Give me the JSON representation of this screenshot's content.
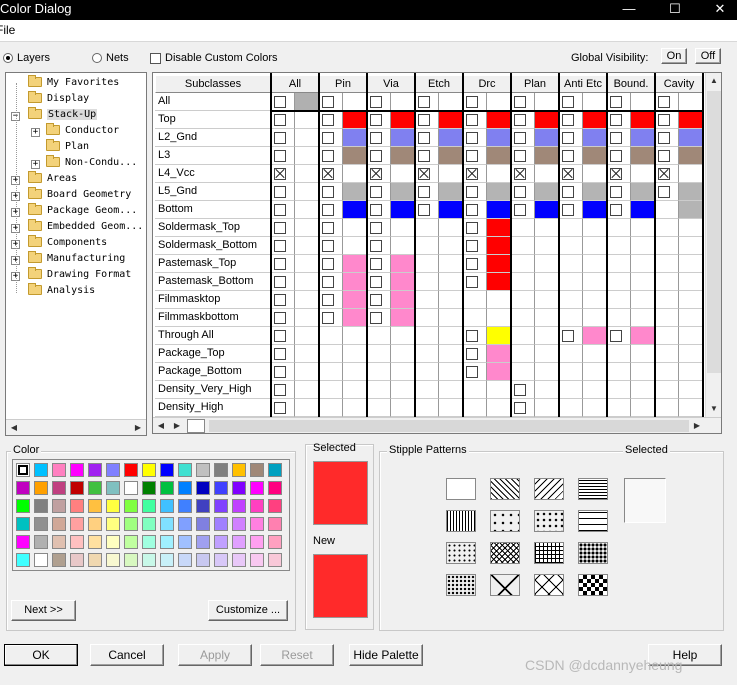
{
  "window": {
    "title": "Color Dialog",
    "minimize": "—",
    "maximize": "☐",
    "close": "✕"
  },
  "menu": {
    "file": "File"
  },
  "options": {
    "layers": "Layers",
    "nets": "Nets",
    "disable_custom": "Disable Custom Colors",
    "global_visibility": "Global Visibility:",
    "on": "On",
    "off": "Off"
  },
  "tree": [
    {
      "label": "My Favorites",
      "level": 0
    },
    {
      "label": "Display",
      "level": 0
    },
    {
      "label": "Stack-Up",
      "level": 0,
      "expanded": true,
      "selected": true
    },
    {
      "label": "Conductor",
      "level": 1,
      "expander": "+"
    },
    {
      "label": "Plan",
      "level": 1
    },
    {
      "label": "Non-Condu...",
      "level": 1,
      "expander": "+"
    },
    {
      "label": "Areas",
      "level": 0,
      "expander": "+"
    },
    {
      "label": "Board Geometry",
      "level": 0,
      "expander": "+"
    },
    {
      "label": "Package Geom...",
      "level": 0,
      "expander": "+"
    },
    {
      "label": "Embedded Geom...",
      "level": 0,
      "expander": "+"
    },
    {
      "label": "Components",
      "level": 0,
      "expander": "+"
    },
    {
      "label": "Manufacturing",
      "level": 0,
      "expander": "+"
    },
    {
      "label": "Drawing Format",
      "level": 0,
      "expander": "+"
    },
    {
      "label": "Analysis",
      "level": 0
    }
  ],
  "grid": {
    "header_label": "Subclasses",
    "columns": [
      "All",
      "Pin",
      "Via",
      "Etch",
      "Drc",
      "Plan",
      "Anti Etc",
      "Bound.",
      "Cavity"
    ],
    "rows": [
      {
        "name": "All",
        "cells": [
          [
            "cb",
            "#b0b0b0"
          ],
          [
            "cb",
            "#fff"
          ],
          [
            "cb",
            "#fff"
          ],
          [
            "cb",
            "#fff"
          ],
          [
            "cb",
            "#fff"
          ],
          [
            "cb",
            "#fff"
          ],
          [
            "cb",
            "#fff"
          ],
          [
            "cb",
            "#fff"
          ],
          [
            "cb",
            "#fff"
          ]
        ]
      },
      {
        "name": "Top",
        "cells": [
          [
            "cb",
            ""
          ],
          [
            "cb",
            "#ff0000"
          ],
          [
            "cb",
            "#ff0000"
          ],
          [
            "cb",
            "#ff0000"
          ],
          [
            "cb",
            "#ff0000"
          ],
          [
            "cb",
            "#ff0000"
          ],
          [
            "cb",
            "#ff0000"
          ],
          [
            "cb",
            "#ff0000"
          ],
          [
            "cb",
            "#ff0000"
          ]
        ]
      },
      {
        "name": "L2_Gnd",
        "cells": [
          [
            "cb",
            ""
          ],
          [
            "cb",
            "#8080f0"
          ],
          [
            "cb",
            "#8080f0"
          ],
          [
            "cb",
            "#8080f0"
          ],
          [
            "cb",
            "#8080f0"
          ],
          [
            "cb",
            "#8080f0"
          ],
          [
            "cb",
            "#8080f0"
          ],
          [
            "cb",
            "#8080f0"
          ],
          [
            "cb",
            "#8080f0"
          ]
        ]
      },
      {
        "name": "L3",
        "cells": [
          [
            "cb",
            ""
          ],
          [
            "cb",
            "#a08878"
          ],
          [
            "cb",
            "#a08878"
          ],
          [
            "cb",
            "#a08878"
          ],
          [
            "cb",
            "#a08878"
          ],
          [
            "cb",
            "#a08878"
          ],
          [
            "cb",
            "#a08878"
          ],
          [
            "cb",
            "#a08878"
          ],
          [
            "cb",
            "#a08878"
          ]
        ]
      },
      {
        "name": "L4_Vcc",
        "cells": [
          [
            "x",
            ""
          ],
          [
            "x",
            ""
          ],
          [
            "x",
            ""
          ],
          [
            "x",
            ""
          ],
          [
            "x",
            ""
          ],
          [
            "x",
            ""
          ],
          [
            "x",
            ""
          ],
          [
            "x",
            ""
          ],
          [
            "x",
            ""
          ]
        ]
      },
      {
        "name": "L5_Gnd",
        "cells": [
          [
            "cb",
            ""
          ],
          [
            "cb",
            "#b4b4b4"
          ],
          [
            "cb",
            "#b4b4b4"
          ],
          [
            "cb",
            "#b4b4b4"
          ],
          [
            "cb",
            "#b4b4b4"
          ],
          [
            "cb",
            "#b4b4b4"
          ],
          [
            "cb",
            "#b4b4b4"
          ],
          [
            "cb",
            "#b4b4b4"
          ],
          [
            "cb",
            "#b4b4b4"
          ]
        ]
      },
      {
        "name": "Bottom",
        "cells": [
          [
            "cb",
            ""
          ],
          [
            "cb",
            "#0000ff"
          ],
          [
            "cb",
            "#0000ff"
          ],
          [
            "cb",
            "#0000ff"
          ],
          [
            "cb",
            "#0000ff"
          ],
          [
            "cb",
            "#0000ff"
          ],
          [
            "cb",
            "#0000ff"
          ],
          [
            "cb",
            "#0000ff"
          ],
          [
            "none",
            "#b4b4b4"
          ]
        ]
      },
      {
        "name": "Soldermask_Top",
        "cells": [
          [
            "cb",
            ""
          ],
          [
            "cb",
            ""
          ],
          [
            "cb",
            ""
          ],
          [
            "",
            ""
          ],
          [
            "cb",
            "#ff0000"
          ],
          [
            "",
            ""
          ],
          [
            "",
            ""
          ],
          [
            "",
            ""
          ],
          [
            "",
            ""
          ]
        ]
      },
      {
        "name": "Soldermask_Bottom",
        "cells": [
          [
            "cb",
            ""
          ],
          [
            "cb",
            ""
          ],
          [
            "cb",
            ""
          ],
          [
            "",
            ""
          ],
          [
            "cb",
            "#ff0000"
          ],
          [
            "",
            ""
          ],
          [
            "",
            ""
          ],
          [
            "",
            ""
          ],
          [
            "",
            ""
          ]
        ]
      },
      {
        "name": "Pastemask_Top",
        "cells": [
          [
            "cb",
            ""
          ],
          [
            "cb",
            "#ff88cc"
          ],
          [
            "cb",
            "#ff88cc"
          ],
          [
            "",
            ""
          ],
          [
            "cb",
            "#ff0000"
          ],
          [
            "",
            ""
          ],
          [
            "",
            ""
          ],
          [
            "",
            ""
          ],
          [
            "",
            ""
          ]
        ]
      },
      {
        "name": "Pastemask_Bottom",
        "cells": [
          [
            "cb",
            ""
          ],
          [
            "cb",
            "#ff88cc"
          ],
          [
            "cb",
            "#ff88cc"
          ],
          [
            "",
            ""
          ],
          [
            "cb",
            "#ff0000"
          ],
          [
            "",
            ""
          ],
          [
            "",
            ""
          ],
          [
            "",
            ""
          ],
          [
            "",
            ""
          ]
        ]
      },
      {
        "name": "Filmmasktop",
        "cells": [
          [
            "cb",
            ""
          ],
          [
            "cb",
            "#ff88cc"
          ],
          [
            "cb",
            "#ff88cc"
          ],
          [
            "",
            ""
          ],
          [
            "",
            ""
          ],
          [
            "",
            ""
          ],
          [
            "",
            ""
          ],
          [
            "",
            ""
          ],
          [
            "",
            ""
          ]
        ]
      },
      {
        "name": "Filmmaskbottom",
        "cells": [
          [
            "cb",
            ""
          ],
          [
            "cb",
            "#ff88cc"
          ],
          [
            "cb",
            "#ff88cc"
          ],
          [
            "",
            ""
          ],
          [
            "",
            ""
          ],
          [
            "",
            ""
          ],
          [
            "",
            ""
          ],
          [
            "",
            ""
          ],
          [
            "",
            ""
          ]
        ]
      },
      {
        "name": "Through All",
        "cells": [
          [
            "cb",
            ""
          ],
          [
            "",
            ""
          ],
          [
            "",
            ""
          ],
          [
            "",
            ""
          ],
          [
            "cb",
            "#ffff00"
          ],
          [
            "",
            ""
          ],
          [
            "cb",
            "#ff88cc"
          ],
          [
            "cb",
            "#ff88cc"
          ],
          [
            "",
            ""
          ]
        ]
      },
      {
        "name": "Package_Top",
        "cells": [
          [
            "cb",
            ""
          ],
          [
            "",
            ""
          ],
          [
            "",
            ""
          ],
          [
            "",
            ""
          ],
          [
            "cb",
            "#ff88cc"
          ],
          [
            "",
            ""
          ],
          [
            "",
            ""
          ],
          [
            "",
            ""
          ],
          [
            "",
            ""
          ]
        ]
      },
      {
        "name": "Package_Bottom",
        "cells": [
          [
            "cb",
            ""
          ],
          [
            "",
            ""
          ],
          [
            "",
            ""
          ],
          [
            "",
            ""
          ],
          [
            "cb",
            "#ff88cc"
          ],
          [
            "",
            ""
          ],
          [
            "",
            ""
          ],
          [
            "",
            ""
          ],
          [
            "",
            ""
          ]
        ]
      },
      {
        "name": "Density_Very_High",
        "cells": [
          [
            "cb",
            ""
          ],
          [
            "",
            ""
          ],
          [
            "",
            ""
          ],
          [
            "",
            ""
          ],
          [
            "",
            ""
          ],
          [
            "cb",
            ""
          ],
          [
            "",
            ""
          ],
          [
            "",
            ""
          ],
          [
            "",
            ""
          ]
        ]
      },
      {
        "name": "Density_High",
        "cells": [
          [
            "cb",
            ""
          ],
          [
            "",
            ""
          ],
          [
            "",
            ""
          ],
          [
            "",
            ""
          ],
          [
            "",
            ""
          ],
          [
            "cb",
            ""
          ],
          [
            "",
            ""
          ],
          [
            "",
            ""
          ],
          [
            "",
            ""
          ]
        ]
      }
    ]
  },
  "color_panel": {
    "label": "Color",
    "next_button": "Next >>",
    "customize_button": "Customize ...",
    "palette": [
      [
        "#ffffff",
        "#00c0ff",
        "#ff80c0",
        "#ff00ff",
        "#a020f0",
        "#8080ff",
        "#ff0000",
        "#ffff00",
        "#0000ff",
        "#40e0d0",
        "#c0c0c0",
        "#808080",
        "#ffc000",
        "#a08878",
        "#00a0c0"
      ],
      [
        "#c000c0",
        "#ffa000",
        "#c04080",
        "#c00000",
        "#40c040",
        "#80c0c0",
        "#ffffff",
        "#008000",
        "#00c040",
        "#0080ff",
        "#0000c0",
        "#4040ff",
        "#8000ff",
        "#ff00ff",
        "#ff0080"
      ],
      [
        "#00ff00",
        "#808080",
        "#c0a0a0",
        "#ff8080",
        "#ffc040",
        "#ffff40",
        "#80ff40",
        "#40ffa0",
        "#40c0ff",
        "#4080ff",
        "#4040c0",
        "#8040ff",
        "#c040ff",
        "#ff40c0",
        "#ff4080"
      ],
      [
        "#00c0c0",
        "#909090",
        "#d0a898",
        "#ffa0a0",
        "#ffd080",
        "#ffff80",
        "#a0ff80",
        "#80ffc0",
        "#80e0ff",
        "#80a0ff",
        "#8080e0",
        "#a080ff",
        "#d080ff",
        "#ff80e0",
        "#ff80b0"
      ],
      [
        "#ff00ff",
        "#b0b0b0",
        "#e0c0b0",
        "#ffc0c0",
        "#ffe0a0",
        "#ffffc0",
        "#c0ffa0",
        "#a0ffe0",
        "#a0f0ff",
        "#a0c0ff",
        "#a0a0f0",
        "#c0a0ff",
        "#e0a0ff",
        "#ffa0f0",
        "#ffa0c0"
      ],
      [
        "#40ffff",
        "#ffffff",
        "#b0a090",
        "#e8c8c8",
        "#f0d8b0",
        "#f8f8d0",
        "#d8f8c0",
        "#c8f8e8",
        "#c8f0f8",
        "#c8d8f8",
        "#c8c8f0",
        "#d8c8f8",
        "#e8c8f8",
        "#f8c8f0",
        "#f8c8d8"
      ]
    ]
  },
  "selected_panel": {
    "selected": "Selected",
    "new": "New",
    "selected_color": "#ff2a2a",
    "new_color": "#ff2a2a"
  },
  "stipple_panel": {
    "label": "Stipple Patterns",
    "selected": "Selected"
  },
  "footer": {
    "ok": "OK",
    "cancel": "Cancel",
    "apply": "Apply",
    "reset": "Reset",
    "hide_palette": "Hide Palette",
    "help": "Help"
  },
  "watermark": "CSDN @dcdannyeheung"
}
